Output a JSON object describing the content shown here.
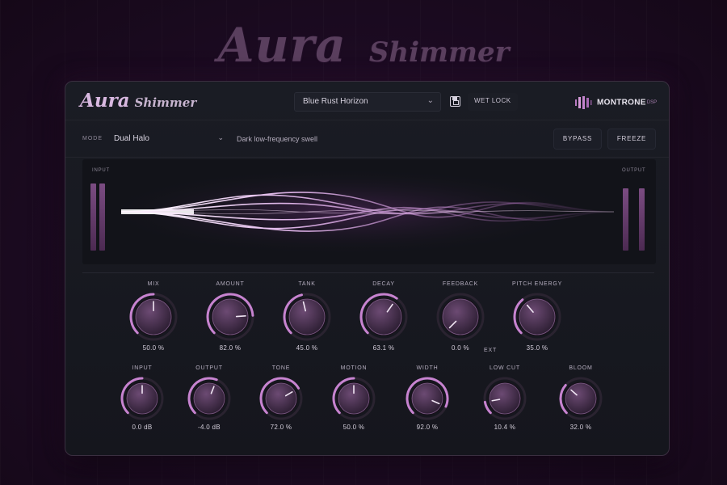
{
  "hero": {
    "title_big": "Aura",
    "title_small": "Shimmer"
  },
  "header": {
    "logo_main": "Aura",
    "logo_sub": "Shimmer",
    "preset": "Blue Rust Horizon",
    "wet_lock": "WET LOCK",
    "brand": "MONTRONE",
    "brand_sub": "DSP"
  },
  "mode": {
    "label": "MODE",
    "selected": "Dual Halo",
    "description": "Dark low-frequency swell",
    "bypass": "BYPASS",
    "freeze": "FREEZE"
  },
  "meters": {
    "input_label": "INPUT",
    "output_label": "OUTPUT",
    "input_levels": [
      0.95,
      0.95
    ],
    "output_levels": [
      0.7,
      0.7
    ]
  },
  "knobs_row1": [
    {
      "id": "mix",
      "label": "MIX",
      "value": "50.0 %",
      "level": 0.5
    },
    {
      "id": "amount",
      "label": "AMOUNT",
      "value": "82.0 %",
      "level": 0.82
    },
    {
      "id": "tank",
      "label": "TANK",
      "value": "45.0 %",
      "level": 0.45
    },
    {
      "id": "decay",
      "label": "DECAY",
      "value": "63.1 %",
      "level": 0.631
    },
    {
      "id": "feedback",
      "label": "FEEDBACK",
      "value": "0.0 %",
      "level": 0.0
    },
    {
      "id": "pitch-energy",
      "label": "PITCH ENERGY",
      "value": "35.0 %",
      "level": 0.35
    }
  ],
  "ext_label": "EXT",
  "knobs_row2": [
    {
      "id": "input",
      "label": "INPUT",
      "value": "0.0 dB",
      "level": 0.5
    },
    {
      "id": "output",
      "label": "OUTPUT",
      "value": "-4.0 dB",
      "level": 0.58
    },
    {
      "id": "tone",
      "label": "TONE",
      "value": "72.0 %",
      "level": 0.72
    },
    {
      "id": "motion",
      "label": "MOTION",
      "value": "50.0 %",
      "level": 0.5
    },
    {
      "id": "width",
      "label": "WIDTH",
      "value": "92.0 %",
      "level": 0.92
    },
    {
      "id": "low-cut",
      "label": "LOW CUT",
      "value": "10.4 %",
      "level": 0.13
    },
    {
      "id": "bloom",
      "label": "BLOOM",
      "value": "32.0 %",
      "level": 0.32
    }
  ],
  "colors": {
    "accent": "#c783d0",
    "panel": "#16171e",
    "background": "#1c0b22"
  },
  "icons": [
    "chevron-down-icon",
    "save-icon",
    "montrone-logo-icon"
  ]
}
